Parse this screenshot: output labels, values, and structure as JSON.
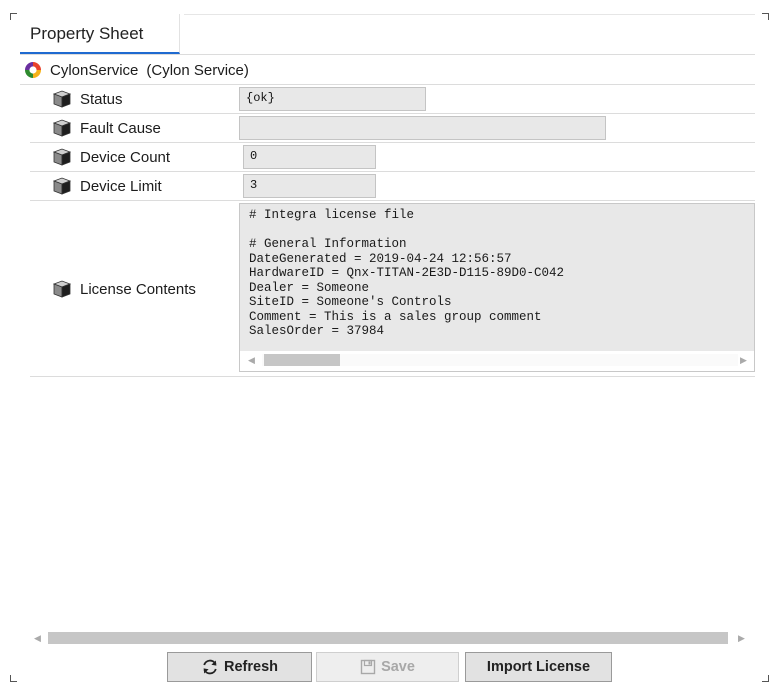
{
  "tab": {
    "label": "Property Sheet"
  },
  "root": {
    "name": "CylonService",
    "type": "(Cylon Service)"
  },
  "properties": [
    {
      "label": "Status",
      "value": "{ok}"
    },
    {
      "label": "Fault Cause",
      "value": ""
    },
    {
      "label": "Device Count",
      "value": "0"
    },
    {
      "label": "Device Limit",
      "value": "3"
    },
    {
      "label": "License Contents"
    }
  ],
  "license_text": "# Integra license file\n\n# General Information\nDateGenerated = 2019-04-24 12:56:57\nHardwareID = Qnx-TITAN-2E3D-D115-89D0-C042\nDealer = Someone\nSiteID = Someone's Controls\nComment = This is a sales group comment\nSalesOrder = 37984",
  "buttons": {
    "refresh": "Refresh",
    "save": "Save",
    "import": "Import License"
  },
  "colors": {
    "tab_underline": "#1f6ad0",
    "field_bg": "#e8e8e8",
    "button_bg": "#e2e2e2"
  }
}
